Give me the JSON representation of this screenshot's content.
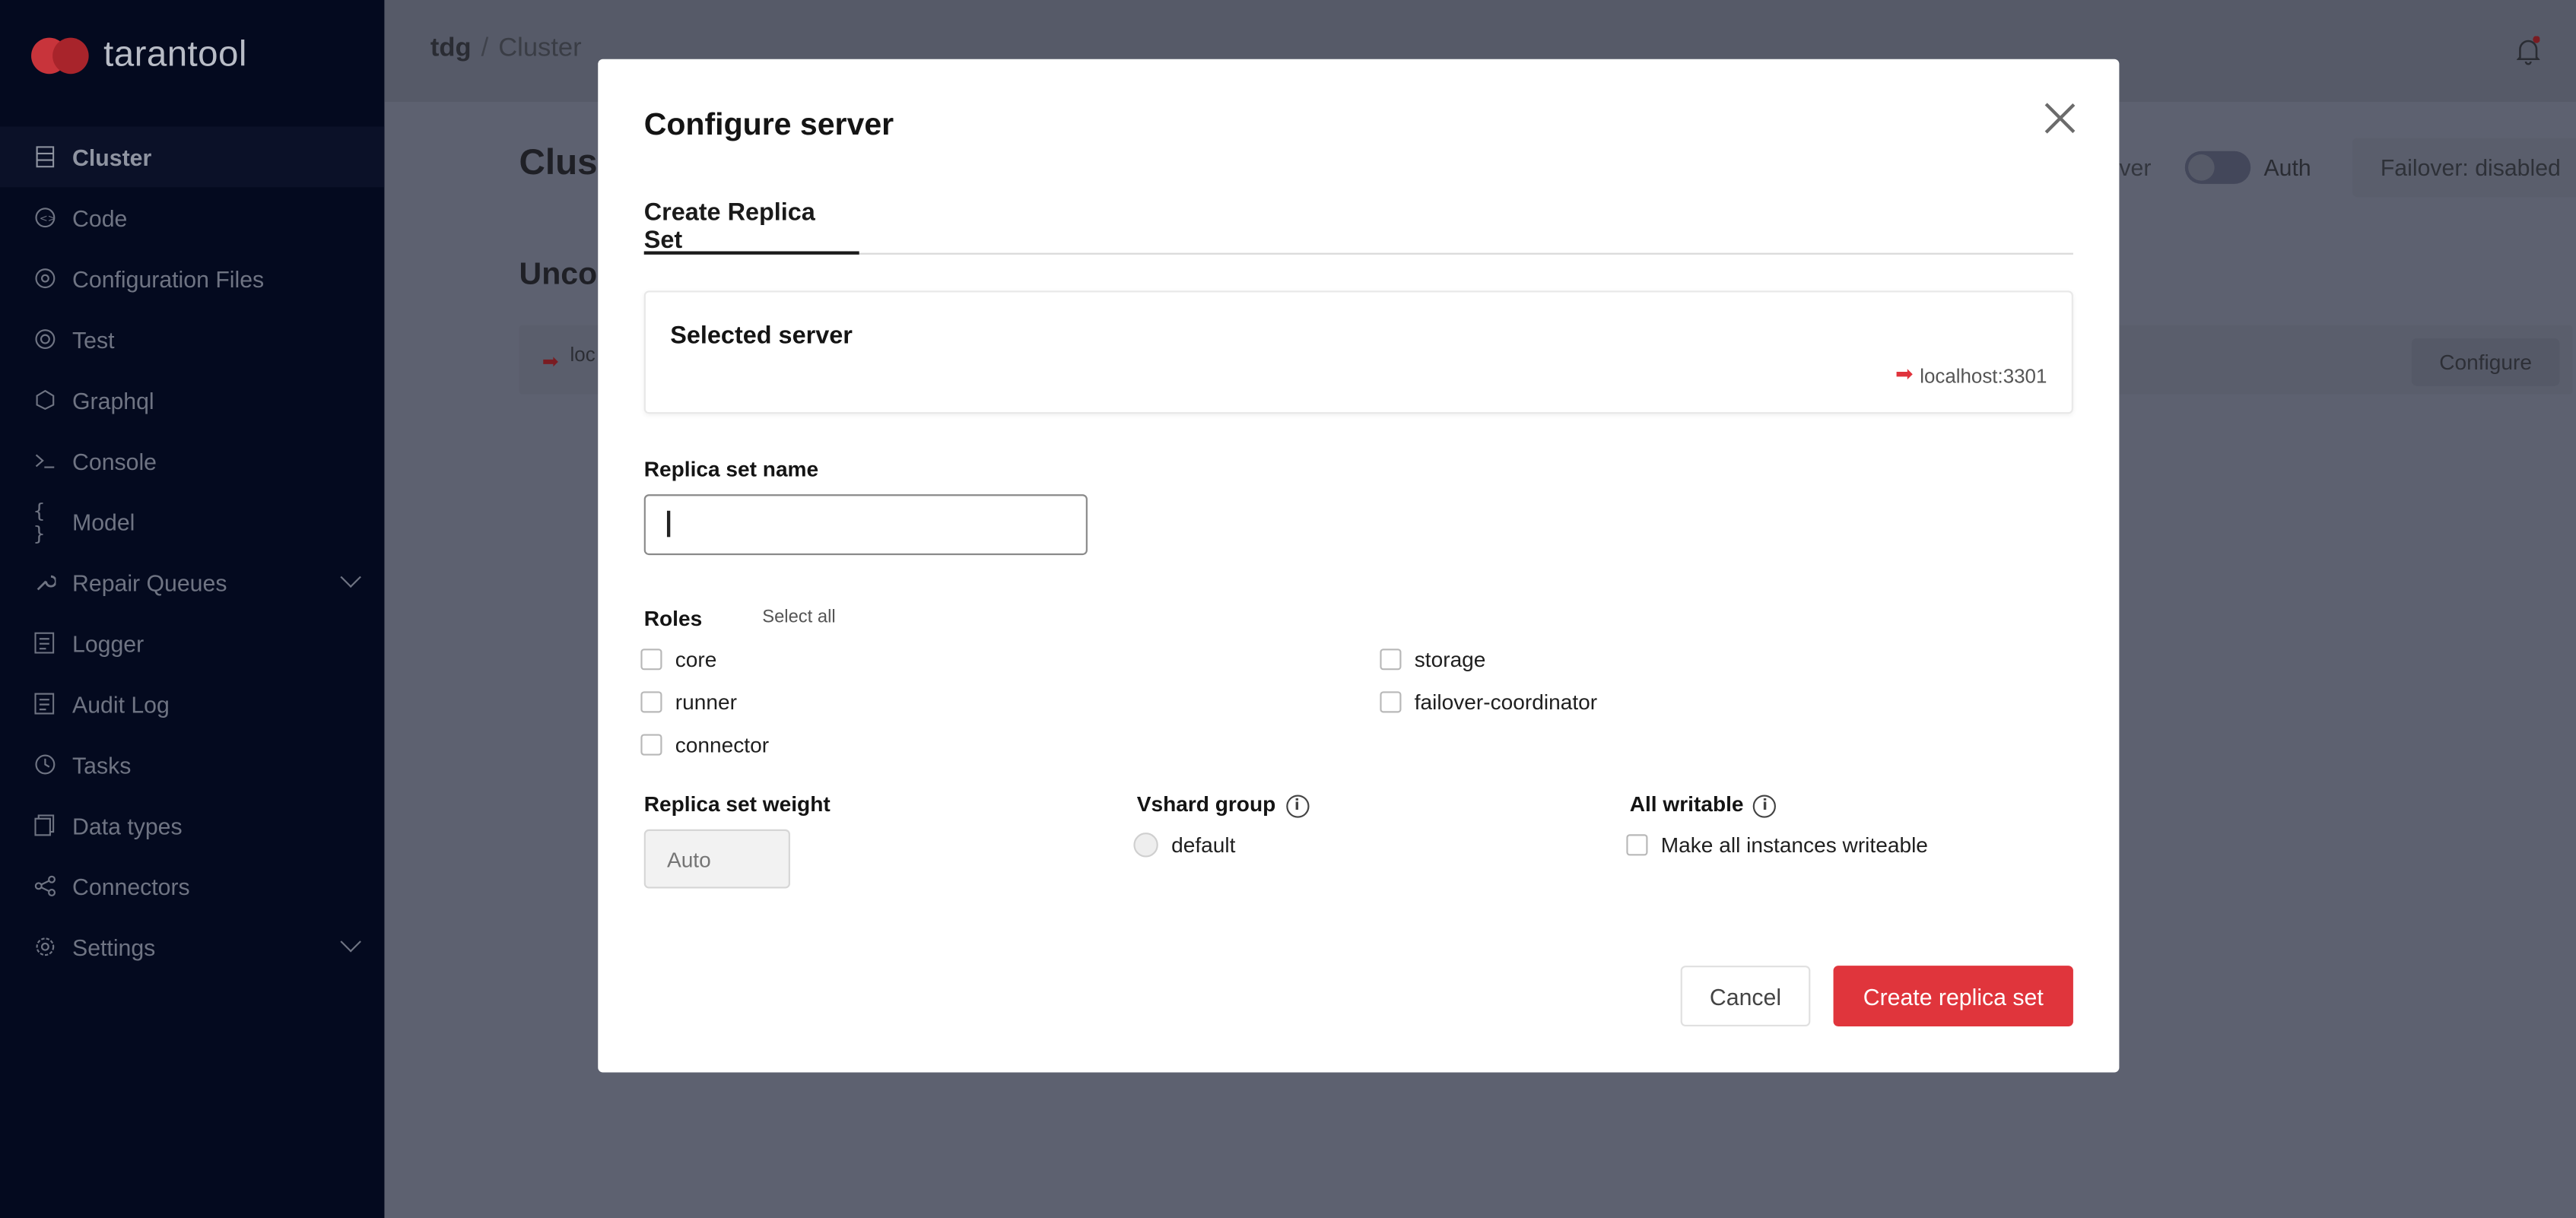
{
  "app": {
    "logo_text": "tarantool"
  },
  "sidebar": {
    "items": [
      {
        "label": "Cluster",
        "icon": "cluster-icon"
      },
      {
        "label": "Code",
        "icon": "code-icon"
      },
      {
        "label": "Configuration Files",
        "icon": "config-files-icon"
      },
      {
        "label": "Test",
        "icon": "test-icon"
      },
      {
        "label": "Graphql",
        "icon": "graphql-icon"
      },
      {
        "label": "Console",
        "icon": "console-icon"
      },
      {
        "label": "Model",
        "icon": "model-icon"
      },
      {
        "label": "Repair Queues",
        "icon": "wrench-icon",
        "expandable": true
      },
      {
        "label": "Logger",
        "icon": "logger-icon"
      },
      {
        "label": "Audit Log",
        "icon": "audit-log-icon"
      },
      {
        "label": "Tasks",
        "icon": "tasks-icon"
      },
      {
        "label": "Data types",
        "icon": "data-types-icon"
      },
      {
        "label": "Connectors",
        "icon": "connectors-icon"
      },
      {
        "label": "Settings",
        "icon": "settings-icon",
        "expandable": true
      }
    ]
  },
  "header": {
    "breadcrumb_root": "tdg",
    "breadcrumb_sep": "/",
    "breadcrumb_current": "Cluster"
  },
  "background": {
    "title": "Clus",
    "subtitle": "Unco",
    "row_label": "loc",
    "configure_label": "Configure",
    "server_label": "ver",
    "auth_label": "Auth",
    "failover_label": "Failover: disabled"
  },
  "modal": {
    "title": "Configure server",
    "tab_label": "Create Replica Set",
    "selected_server_title": "Selected server",
    "selected_server_uri": "localhost:3301",
    "replica_set_name_label": "Replica set name",
    "replica_set_name_value": "",
    "roles_label": "Roles",
    "select_all_label": "Select all",
    "roles": {
      "core": "core",
      "storage": "storage",
      "runner": "runner",
      "failover_coordinator": "failover-coordinator",
      "connector": "connector"
    },
    "weight_label": "Replica set weight",
    "weight_placeholder": "Auto",
    "vshard_label": "Vshard group",
    "vshard_option": "default",
    "all_writable_label": "All writable",
    "all_writable_option": "Make all instances writeable",
    "cancel_label": "Cancel",
    "create_label": "Create replica set"
  },
  "colors": {
    "sidebar_bg": "#040a1f",
    "accent_red": "#e0353c",
    "overlay": "#5d6170"
  }
}
